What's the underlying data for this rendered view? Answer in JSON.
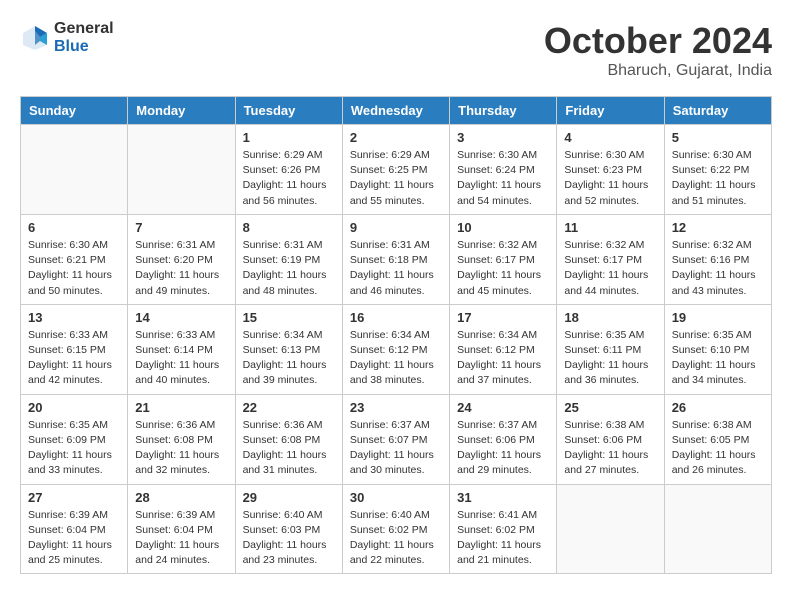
{
  "header": {
    "logo_general": "General",
    "logo_blue": "Blue",
    "month_title": "October 2024",
    "location": "Bharuch, Gujarat, India"
  },
  "weekdays": [
    "Sunday",
    "Monday",
    "Tuesday",
    "Wednesday",
    "Thursday",
    "Friday",
    "Saturday"
  ],
  "weeks": [
    [
      {
        "day": "",
        "info": ""
      },
      {
        "day": "",
        "info": ""
      },
      {
        "day": "1",
        "info": "Sunrise: 6:29 AM\nSunset: 6:26 PM\nDaylight: 11 hours and 56 minutes."
      },
      {
        "day": "2",
        "info": "Sunrise: 6:29 AM\nSunset: 6:25 PM\nDaylight: 11 hours and 55 minutes."
      },
      {
        "day": "3",
        "info": "Sunrise: 6:30 AM\nSunset: 6:24 PM\nDaylight: 11 hours and 54 minutes."
      },
      {
        "day": "4",
        "info": "Sunrise: 6:30 AM\nSunset: 6:23 PM\nDaylight: 11 hours and 52 minutes."
      },
      {
        "day": "5",
        "info": "Sunrise: 6:30 AM\nSunset: 6:22 PM\nDaylight: 11 hours and 51 minutes."
      }
    ],
    [
      {
        "day": "6",
        "info": "Sunrise: 6:30 AM\nSunset: 6:21 PM\nDaylight: 11 hours and 50 minutes."
      },
      {
        "day": "7",
        "info": "Sunrise: 6:31 AM\nSunset: 6:20 PM\nDaylight: 11 hours and 49 minutes."
      },
      {
        "day": "8",
        "info": "Sunrise: 6:31 AM\nSunset: 6:19 PM\nDaylight: 11 hours and 48 minutes."
      },
      {
        "day": "9",
        "info": "Sunrise: 6:31 AM\nSunset: 6:18 PM\nDaylight: 11 hours and 46 minutes."
      },
      {
        "day": "10",
        "info": "Sunrise: 6:32 AM\nSunset: 6:17 PM\nDaylight: 11 hours and 45 minutes."
      },
      {
        "day": "11",
        "info": "Sunrise: 6:32 AM\nSunset: 6:17 PM\nDaylight: 11 hours and 44 minutes."
      },
      {
        "day": "12",
        "info": "Sunrise: 6:32 AM\nSunset: 6:16 PM\nDaylight: 11 hours and 43 minutes."
      }
    ],
    [
      {
        "day": "13",
        "info": "Sunrise: 6:33 AM\nSunset: 6:15 PM\nDaylight: 11 hours and 42 minutes."
      },
      {
        "day": "14",
        "info": "Sunrise: 6:33 AM\nSunset: 6:14 PM\nDaylight: 11 hours and 40 minutes."
      },
      {
        "day": "15",
        "info": "Sunrise: 6:34 AM\nSunset: 6:13 PM\nDaylight: 11 hours and 39 minutes."
      },
      {
        "day": "16",
        "info": "Sunrise: 6:34 AM\nSunset: 6:12 PM\nDaylight: 11 hours and 38 minutes."
      },
      {
        "day": "17",
        "info": "Sunrise: 6:34 AM\nSunset: 6:12 PM\nDaylight: 11 hours and 37 minutes."
      },
      {
        "day": "18",
        "info": "Sunrise: 6:35 AM\nSunset: 6:11 PM\nDaylight: 11 hours and 36 minutes."
      },
      {
        "day": "19",
        "info": "Sunrise: 6:35 AM\nSunset: 6:10 PM\nDaylight: 11 hours and 34 minutes."
      }
    ],
    [
      {
        "day": "20",
        "info": "Sunrise: 6:35 AM\nSunset: 6:09 PM\nDaylight: 11 hours and 33 minutes."
      },
      {
        "day": "21",
        "info": "Sunrise: 6:36 AM\nSunset: 6:08 PM\nDaylight: 11 hours and 32 minutes."
      },
      {
        "day": "22",
        "info": "Sunrise: 6:36 AM\nSunset: 6:08 PM\nDaylight: 11 hours and 31 minutes."
      },
      {
        "day": "23",
        "info": "Sunrise: 6:37 AM\nSunset: 6:07 PM\nDaylight: 11 hours and 30 minutes."
      },
      {
        "day": "24",
        "info": "Sunrise: 6:37 AM\nSunset: 6:06 PM\nDaylight: 11 hours and 29 minutes."
      },
      {
        "day": "25",
        "info": "Sunrise: 6:38 AM\nSunset: 6:06 PM\nDaylight: 11 hours and 27 minutes."
      },
      {
        "day": "26",
        "info": "Sunrise: 6:38 AM\nSunset: 6:05 PM\nDaylight: 11 hours and 26 minutes."
      }
    ],
    [
      {
        "day": "27",
        "info": "Sunrise: 6:39 AM\nSunset: 6:04 PM\nDaylight: 11 hours and 25 minutes."
      },
      {
        "day": "28",
        "info": "Sunrise: 6:39 AM\nSunset: 6:04 PM\nDaylight: 11 hours and 24 minutes."
      },
      {
        "day": "29",
        "info": "Sunrise: 6:40 AM\nSunset: 6:03 PM\nDaylight: 11 hours and 23 minutes."
      },
      {
        "day": "30",
        "info": "Sunrise: 6:40 AM\nSunset: 6:02 PM\nDaylight: 11 hours and 22 minutes."
      },
      {
        "day": "31",
        "info": "Sunrise: 6:41 AM\nSunset: 6:02 PM\nDaylight: 11 hours and 21 minutes."
      },
      {
        "day": "",
        "info": ""
      },
      {
        "day": "",
        "info": ""
      }
    ]
  ]
}
